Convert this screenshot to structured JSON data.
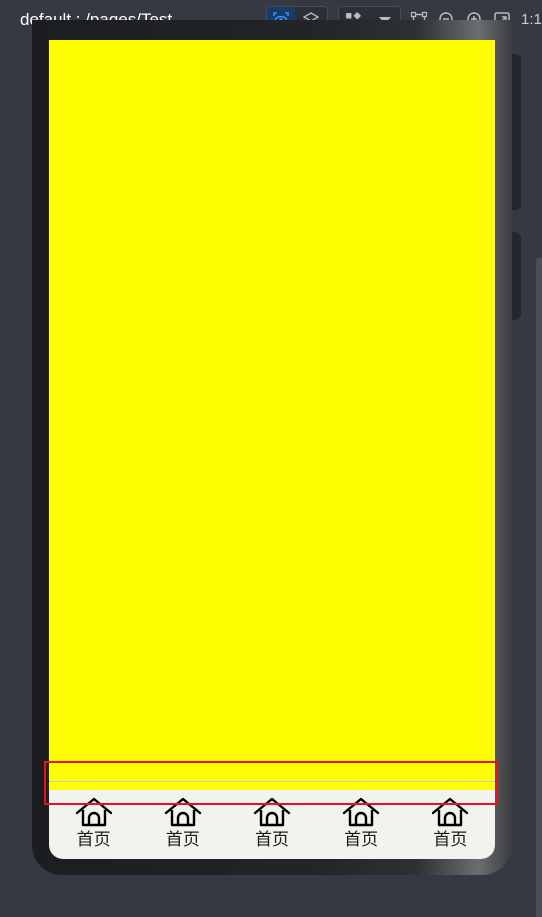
{
  "toolbar": {
    "page_path": "default : /pages/Test",
    "group1": [
      {
        "icon": "eye-icon",
        "active": true
      },
      {
        "icon": "layers-icon",
        "active": false
      }
    ],
    "group2": [
      {
        "icon": "grid-icon"
      },
      {
        "icon": "chevron-down-icon"
      }
    ],
    "tools": [
      {
        "icon": "frame-icon"
      },
      {
        "icon": "zoom-out-icon"
      },
      {
        "icon": "zoom-in-icon"
      },
      {
        "icon": "fit-screen-icon"
      }
    ],
    "ratio_label": "1:1"
  },
  "colors": {
    "background": "#343944",
    "content_fill": "#ffff00",
    "tabbar_bg": "#f1f3ef",
    "active_button": "#173c66",
    "selection_border": "#e5141d"
  },
  "preview": {
    "tabs": [
      {
        "label": "首页",
        "icon": "home-icon"
      },
      {
        "label": "首页",
        "icon": "home-icon"
      },
      {
        "label": "首页",
        "icon": "home-icon"
      },
      {
        "label": "首页",
        "icon": "home-icon"
      },
      {
        "label": "首页",
        "icon": "home-icon"
      }
    ]
  }
}
